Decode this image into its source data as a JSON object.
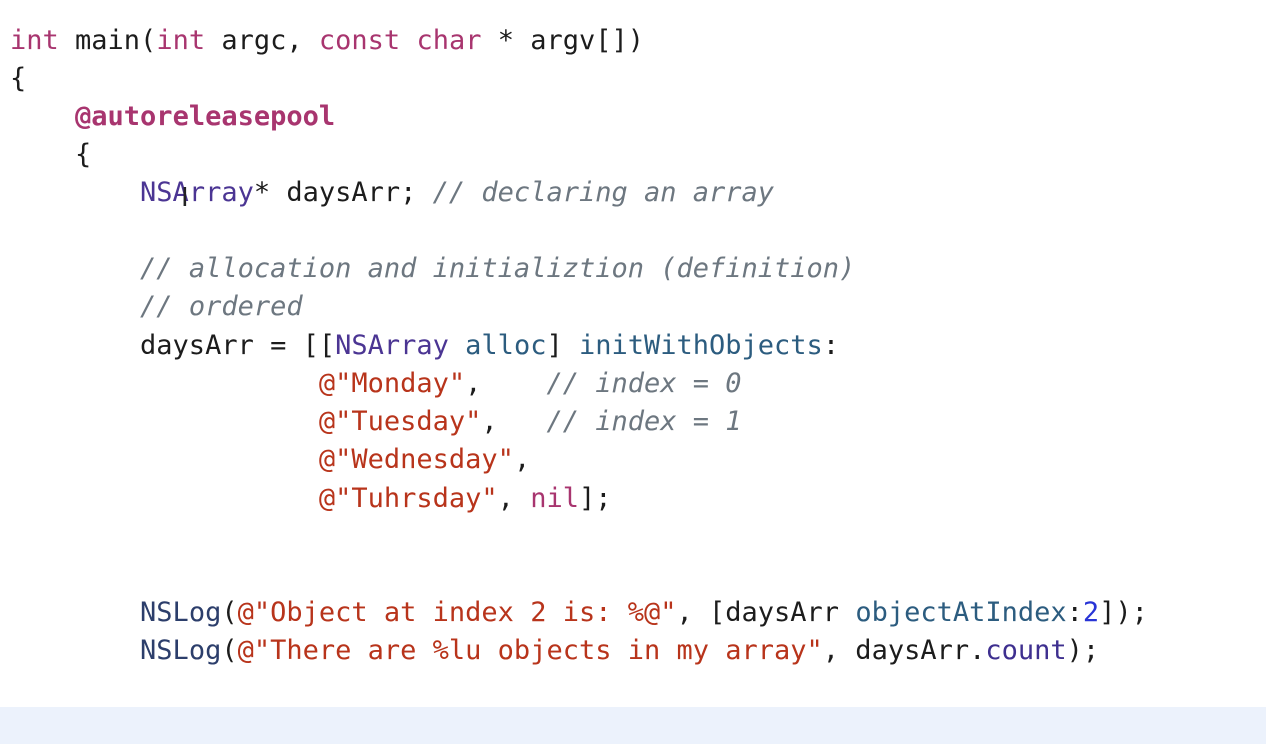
{
  "editor": {
    "lines": [
      {
        "segments": [
          {
            "t": "int",
            "c": "kw"
          },
          {
            "t": " main(",
            "c": ""
          },
          {
            "t": "int",
            "c": "kw"
          },
          {
            "t": " argc, ",
            "c": ""
          },
          {
            "t": "const",
            "c": "kw"
          },
          {
            "t": " ",
            "c": ""
          },
          {
            "t": "char",
            "c": "kw"
          },
          {
            "t": " * argv[])",
            "c": ""
          }
        ]
      },
      {
        "segments": [
          {
            "t": "{",
            "c": ""
          }
        ]
      },
      {
        "segments": [
          {
            "t": "    ",
            "c": ""
          },
          {
            "t": "@autoreleasepool",
            "c": "kwb"
          }
        ]
      },
      {
        "segments": [
          {
            "t": "    {",
            "c": ""
          }
        ]
      },
      {
        "segments": [
          {
            "t": "        ",
            "c": ""
          },
          {
            "t": "NSArray",
            "c": "cls"
          },
          {
            "t": "* daysArr; ",
            "c": ""
          },
          {
            "t": "// declaring an array",
            "c": "cmt"
          }
        ]
      },
      {
        "segments": [
          {
            "t": "",
            "c": ""
          }
        ]
      },
      {
        "segments": [
          {
            "t": "        ",
            "c": ""
          },
          {
            "t": "// allocation and initializtion (definition)",
            "c": "cmt"
          }
        ]
      },
      {
        "segments": [
          {
            "t": "        ",
            "c": ""
          },
          {
            "t": "// ordered",
            "c": "cmt"
          }
        ]
      },
      {
        "segments": [
          {
            "t": "        daysArr = [[",
            "c": ""
          },
          {
            "t": "NSArray",
            "c": "cls"
          },
          {
            "t": " ",
            "c": ""
          },
          {
            "t": "alloc",
            "c": "meth"
          },
          {
            "t": "] ",
            "c": ""
          },
          {
            "t": "initWithObjects",
            "c": "meth"
          },
          {
            "t": ":",
            "c": ""
          }
        ]
      },
      {
        "segments": [
          {
            "t": "                   ",
            "c": ""
          },
          {
            "t": "@\"Monday\"",
            "c": "str"
          },
          {
            "t": ",    ",
            "c": ""
          },
          {
            "t": "// index = 0",
            "c": "cmt"
          }
        ]
      },
      {
        "segments": [
          {
            "t": "                   ",
            "c": ""
          },
          {
            "t": "@\"Tuesday\"",
            "c": "str"
          },
          {
            "t": ",   ",
            "c": ""
          },
          {
            "t": "// index = 1",
            "c": "cmt"
          }
        ]
      },
      {
        "segments": [
          {
            "t": "                   ",
            "c": ""
          },
          {
            "t": "@\"Wednesday\"",
            "c": "str"
          },
          {
            "t": ",",
            "c": ""
          }
        ]
      },
      {
        "segments": [
          {
            "t": "                   ",
            "c": ""
          },
          {
            "t": "@\"Tuhrsday\"",
            "c": "str"
          },
          {
            "t": ", ",
            "c": ""
          },
          {
            "t": "nil",
            "c": "kw"
          },
          {
            "t": "];",
            "c": ""
          }
        ]
      },
      {
        "segments": [
          {
            "t": "",
            "c": ""
          }
        ]
      },
      {
        "segments": [
          {
            "t": "",
            "c": ""
          }
        ]
      },
      {
        "segments": [
          {
            "t": "        ",
            "c": ""
          },
          {
            "t": "NSLog",
            "c": "nsl"
          },
          {
            "t": "(",
            "c": ""
          },
          {
            "t": "@\"Object at index 2 is: %@\"",
            "c": "str"
          },
          {
            "t": ", [daysArr ",
            "c": ""
          },
          {
            "t": "objectAtIndex",
            "c": "meth"
          },
          {
            "t": ":",
            "c": ""
          },
          {
            "t": "2",
            "c": "num"
          },
          {
            "t": "]);",
            "c": ""
          }
        ]
      },
      {
        "segments": [
          {
            "t": "        ",
            "c": ""
          },
          {
            "t": "NSLog",
            "c": "nsl"
          },
          {
            "t": "(",
            "c": ""
          },
          {
            "t": "@\"There are %lu objects in my array\"",
            "c": "str"
          },
          {
            "t": ", daysArr.",
            "c": ""
          },
          {
            "t": "count",
            "c": "prop"
          },
          {
            "t": ");",
            "c": ""
          }
        ]
      }
    ]
  },
  "cursor": {
    "glyph": "I"
  }
}
